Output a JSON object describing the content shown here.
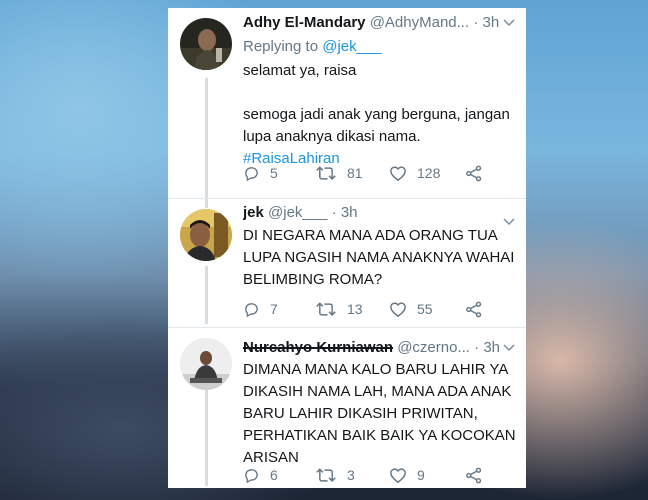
{
  "tweets": [
    {
      "name": "Adhy El-Mandary",
      "handle": "@AdhyMand...",
      "dot": "·",
      "time": "3h",
      "replying_prefix": "Replying to",
      "replying_to": "@jek___",
      "lines": [
        "selamat ya, raisa",
        "",
        "semoga jadi anak yang berguna, jangan",
        "lupa anaknya dikasi nama."
      ],
      "hashtag": "#RaisaLahiran",
      "replies": "5",
      "retweets": "81",
      "likes": "128"
    },
    {
      "name": "jek",
      "handle": "@jek___",
      "dot": "·",
      "time": "3h",
      "lines": [
        "DI NEGARA MANA ADA ORANG TUA",
        "LUPA NGASIH NAMA ANAKNYA WAHAI",
        "BELIMBING ROMA?"
      ],
      "replies": "7",
      "retweets": "13",
      "likes": "55"
    },
    {
      "name": "Nurcahyo Kurniawan",
      "handle": "@czerno...",
      "dot": "·",
      "time": "3h",
      "lines": [
        "DIMANA MANA KALO BARU LAHIR YA",
        "DIKASIH NAMA LAH, MANA ADA ANAK",
        "BARU LAHIR DIKASIH PRIWITAN,",
        "PERHATIKAN BAIK BAIK YA KOCOKAN",
        "ARISAN"
      ],
      "replies": "6",
      "retweets": "3",
      "likes": "9"
    }
  ],
  "icons": {
    "reply": "reply-icon",
    "retweet": "retweet-icon",
    "like": "heart-icon",
    "share": "share-icon",
    "caret": "chevron-down-icon"
  },
  "colors": {
    "link": "#1b95e0",
    "text": "#14171a",
    "muted": "#657786",
    "thread_line": "#d6dde3"
  }
}
